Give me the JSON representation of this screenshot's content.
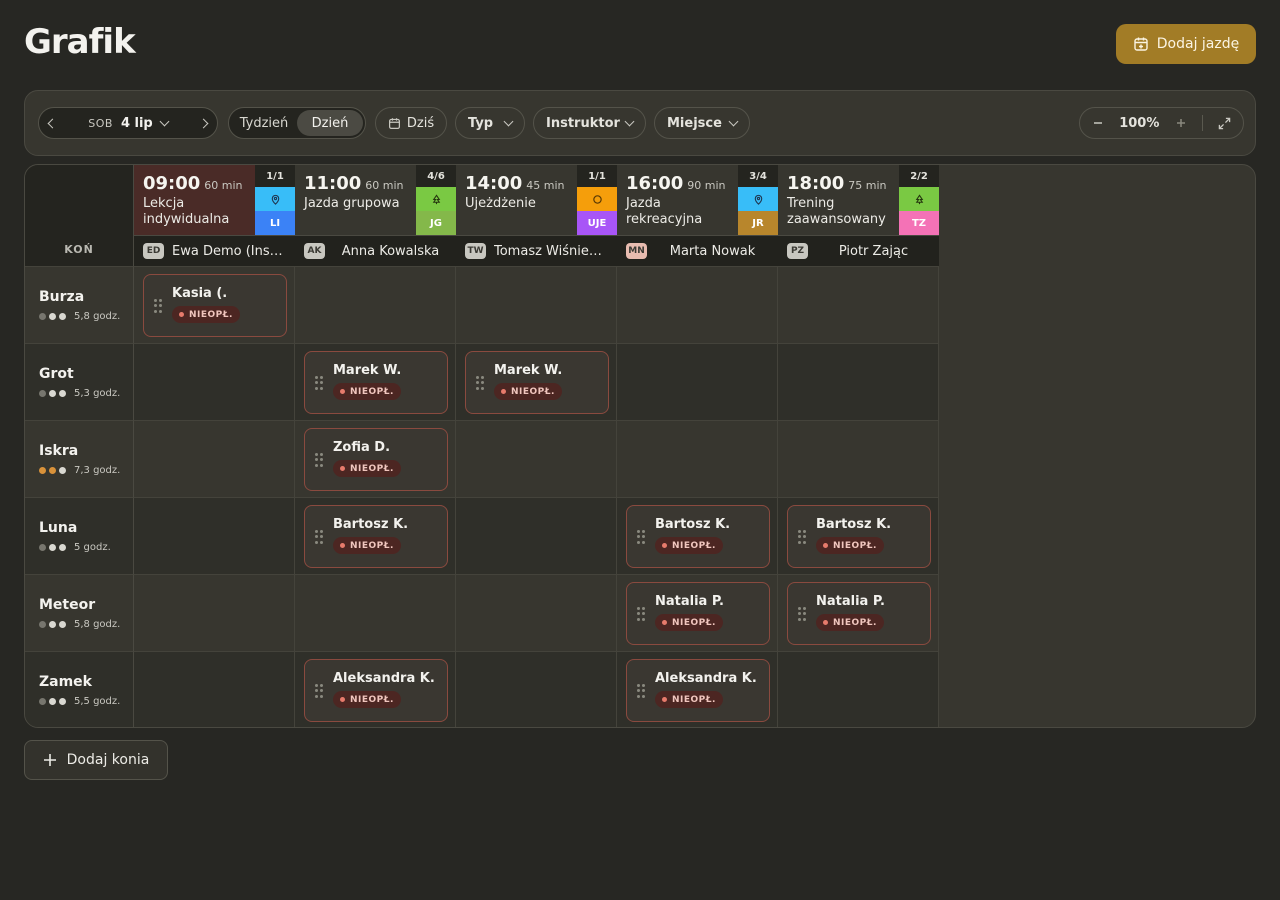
{
  "header": {
    "title": "Grafik",
    "add_ride_label": "Dodaj jazdę"
  },
  "toolbar": {
    "day": "SOB",
    "date": "4 lip",
    "view_week": "Tydzień",
    "view_day": "Dzień",
    "active_view": "Dzień",
    "today": "Dziś",
    "filter_type": "Typ",
    "filter_instructor": "Instruktor",
    "filter_place": "Miejsce",
    "zoom": "100%"
  },
  "grid": {
    "horse_column_label": "KOŃ",
    "slots": [
      {
        "time": "09:00",
        "duration": "60 min",
        "name": "Lekcja indywidualna",
        "count": "1/1",
        "icon": "pin-icon",
        "code": "LI",
        "code_color": "#3b82f6",
        "icon_color": "#38bdf8",
        "head_bg": "#4a2b27",
        "instructor_initials": "ED",
        "instructor": "Ewa Demo (Instr…",
        "avatar_color": "#c8c7c0"
      },
      {
        "time": "11:00",
        "duration": "60 min",
        "name": "Jazda grupowa",
        "count": "4/6",
        "icon": "tree-icon",
        "code": "JG",
        "code_color": "#84b84a",
        "icon_color": "#7ac943",
        "head_bg": "#37362f",
        "instructor_initials": "AK",
        "instructor": "Anna Kowalska",
        "avatar_color": "#c8c7c0"
      },
      {
        "time": "14:00",
        "duration": "45 min",
        "name": "Ujeżdżenie",
        "count": "1/1",
        "icon": "circle-icon",
        "code": "UJE",
        "code_color": "#a855f7",
        "icon_color": "#f59e0b",
        "head_bg": "#37362f",
        "instructor_initials": "TW",
        "instructor": "Tomasz Wiśniew…",
        "avatar_color": "#c8c7c0"
      },
      {
        "time": "16:00",
        "duration": "90 min",
        "name": "Jazda rekreacyjna",
        "count": "3/4",
        "icon": "pin-icon",
        "code": "JR",
        "code_color": "#b8862c",
        "icon_color": "#38bdf8",
        "head_bg": "#37362f",
        "instructor_initials": "MN",
        "instructor": "Marta Nowak",
        "avatar_color": "#e8bcb0"
      },
      {
        "time": "18:00",
        "duration": "75 min",
        "name": "Trening zaawansowany",
        "count": "2/2",
        "icon": "tree-icon",
        "code": "TZ",
        "code_color": "#f472b6",
        "icon_color": "#7ac943",
        "head_bg": "#37362f",
        "instructor_initials": "PZ",
        "instructor": "Piotr Zając",
        "avatar_color": "#c8c7c0"
      }
    ],
    "horses": [
      {
        "name": "Burza",
        "hours": "5,8 godz.",
        "level": [
          "dim",
          "full",
          "full"
        ]
      },
      {
        "name": "Grot",
        "hours": "5,3 godz.",
        "level": [
          "dim",
          "full",
          "full"
        ]
      },
      {
        "name": "Iskra",
        "hours": "7,3 godz.",
        "level": [
          "warm",
          "warm",
          "full"
        ]
      },
      {
        "name": "Luna",
        "hours": "5 godz.",
        "level": [
          "dim",
          "full",
          "full"
        ]
      },
      {
        "name": "Meteor",
        "hours": "5,8 godz.",
        "level": [
          "dim",
          "full",
          "full"
        ]
      },
      {
        "name": "Zamek",
        "hours": "5,5 godz.",
        "level": [
          "dim",
          "full",
          "full"
        ]
      }
    ],
    "bookings": [
      {
        "horse": 0,
        "slot": 0,
        "rider": "Kasia (.",
        "status": "NIEOPŁ."
      },
      {
        "horse": 1,
        "slot": 1,
        "rider": "Marek W.",
        "status": "NIEOPŁ."
      },
      {
        "horse": 1,
        "slot": 2,
        "rider": "Marek W.",
        "status": "NIEOPŁ."
      },
      {
        "horse": 2,
        "slot": 1,
        "rider": "Zofia D.",
        "status": "NIEOPŁ."
      },
      {
        "horse": 3,
        "slot": 1,
        "rider": "Bartosz K.",
        "status": "NIEOPŁ."
      },
      {
        "horse": 3,
        "slot": 3,
        "rider": "Bartosz K.",
        "status": "NIEOPŁ."
      },
      {
        "horse": 3,
        "slot": 4,
        "rider": "Bartosz K.",
        "status": "NIEOPŁ."
      },
      {
        "horse": 4,
        "slot": 3,
        "rider": "Natalia P.",
        "status": "NIEOPŁ."
      },
      {
        "horse": 4,
        "slot": 4,
        "rider": "Natalia P.",
        "status": "NIEOPŁ."
      },
      {
        "horse": 5,
        "slot": 1,
        "rider": "Aleksandra K.",
        "status": "NIEOPŁ."
      },
      {
        "horse": 5,
        "slot": 3,
        "rider": "Aleksandra K.",
        "status": "NIEOPŁ."
      }
    ]
  },
  "footer": {
    "add_horse_label": "Dodaj konia"
  }
}
